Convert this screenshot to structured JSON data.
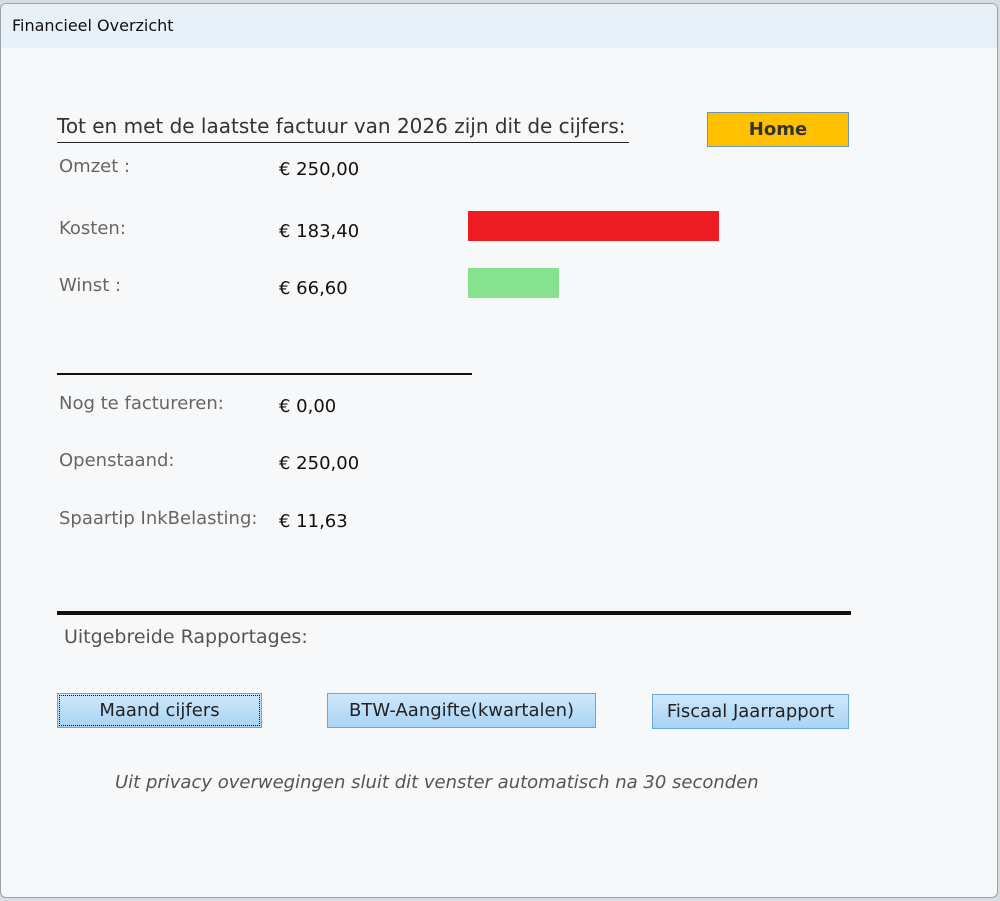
{
  "window": {
    "title": "Financieel Overzicht"
  },
  "summary": {
    "heading": "Tot en met de laatste factuur van 2026 zijn dit de cijfers:",
    "home_label": "Home",
    "omzet": {
      "label": "Omzet :",
      "value": "€ 250,00"
    },
    "kosten": {
      "label": "Kosten:",
      "value": "€ 183,40",
      "bar_fraction": 0.7336,
      "bar_color": "#ee1c25"
    },
    "winst": {
      "label": "Winst :",
      "value": "€ 66,60",
      "bar_fraction": 0.2664,
      "bar_color": "#86e28e"
    }
  },
  "details": {
    "nog_te_factureren": {
      "label": "Nog te factureren:",
      "value": "€ 0,00"
    },
    "openstaand": {
      "label": "Openstaand:",
      "value": "€ 250,00"
    },
    "spaartip": {
      "label": "Spaartip InkBelasting:",
      "value": "€ 11,63"
    }
  },
  "reports": {
    "title": "Uitgebreide Rapportages:",
    "buttons": {
      "maand": "Maand cijfers",
      "btw": "BTW-Aangifte(kwartalen)",
      "fiscaal": "Fiscaal Jaarrapport"
    }
  },
  "footer": {
    "privacy_note": "Uit privacy overwegingen sluit dit venster automatisch na 30 seconden"
  },
  "colors": {
    "home_button": "#ffc000",
    "accent_button": "#a9d3f3"
  }
}
